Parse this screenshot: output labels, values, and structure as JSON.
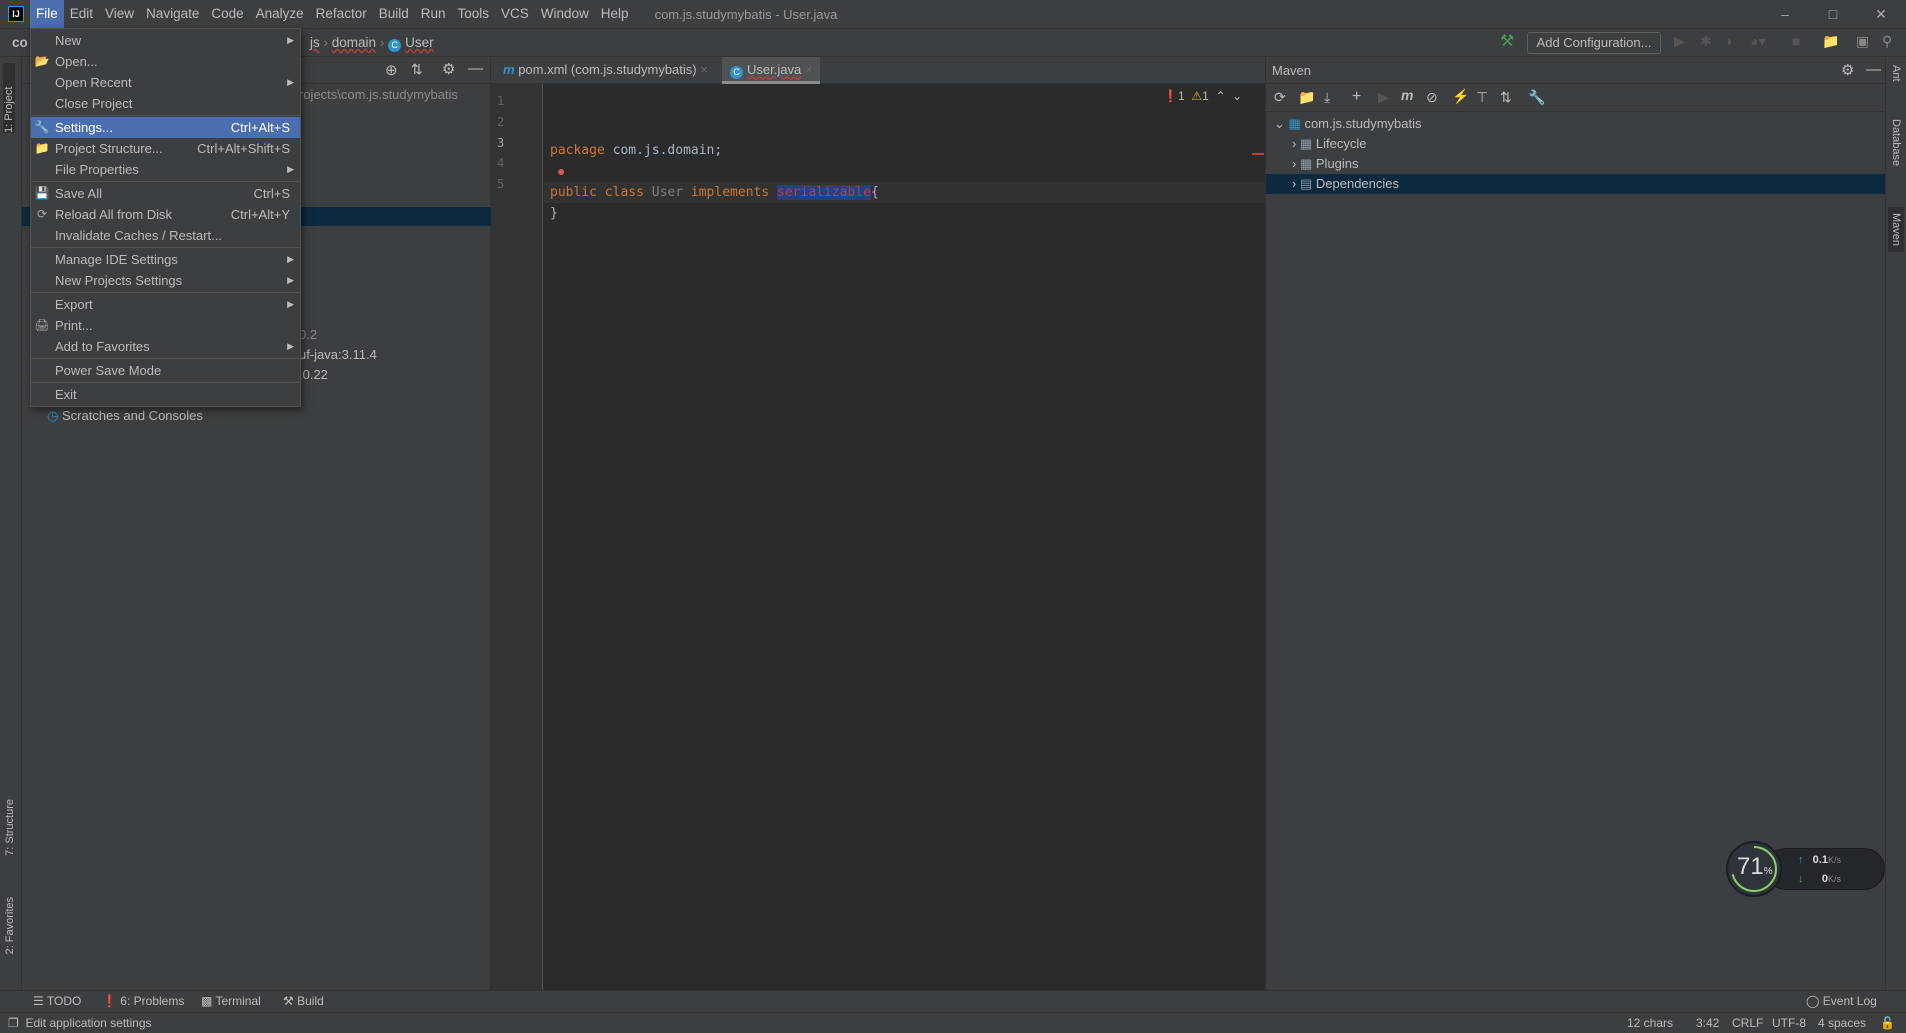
{
  "menubar": {
    "items": [
      "File",
      "Edit",
      "View",
      "Navigate",
      "Code",
      "Analyze",
      "Refactor",
      "Build",
      "Run",
      "Tools",
      "VCS",
      "Window",
      "Help"
    ],
    "active": "File",
    "window_title": "com.js.studymybatis - User.java"
  },
  "navbar": {
    "project_short": "co",
    "crumbs": [
      "js",
      "domain",
      "User"
    ],
    "add_config": "Add Configuration..."
  },
  "file_menu": [
    {
      "label": "New",
      "submenu": true
    },
    {
      "label": "Open...",
      "icon": "folder-open-icon"
    },
    {
      "label": "Open Recent",
      "submenu": true
    },
    {
      "label": "Close Project"
    },
    {
      "sep": true
    },
    {
      "label": "Settings...",
      "shortcut": "Ctrl+Alt+S",
      "icon": "wrench-icon",
      "highlighted": true
    },
    {
      "label": "Project Structure...",
      "shortcut": "Ctrl+Alt+Shift+S",
      "icon": "project-structure-icon"
    },
    {
      "label": "File Properties",
      "submenu": true
    },
    {
      "sep": true
    },
    {
      "label": "Save All",
      "shortcut": "Ctrl+S",
      "icon": "save-icon"
    },
    {
      "label": "Reload All from Disk",
      "shortcut": "Ctrl+Alt+Y",
      "icon": "reload-icon"
    },
    {
      "label": "Invalidate Caches / Restart..."
    },
    {
      "sep": true
    },
    {
      "label": "Manage IDE Settings",
      "submenu": true
    },
    {
      "label": "New Projects Settings",
      "submenu": true
    },
    {
      "sep": true
    },
    {
      "label": "Export",
      "submenu": true
    },
    {
      "label": "Print...",
      "icon": "print-icon"
    },
    {
      "label": "Add to Favorites",
      "submenu": true
    },
    {
      "sep": true
    },
    {
      "label": "Power Save Mode"
    },
    {
      "sep": true
    },
    {
      "label": "Exit"
    }
  ],
  "project": {
    "tool_label": "1: Project",
    "path": "rojects\\com.js.studymybatis",
    "lib1": "0.2",
    "lib2": "uf-java:3.11.4",
    "lib3": ".0.22",
    "scratches": "Scratches and Consoles"
  },
  "editor": {
    "tabs": [
      "pom.xml (com.js.studymybatis)",
      "User.java"
    ],
    "active_tab": "User.java",
    "line_numbers": [
      "1",
      "2",
      "3",
      "4",
      "5"
    ],
    "code": {
      "l1_kw": "package",
      "l1_rest": " com.js.domain;",
      "l3_kw1": "public",
      "l3_kw2": "class",
      "l3_cls": "User",
      "l3_kw3": "implements",
      "l3_err": "serializable",
      "l3_end": "{",
      "l4": "}"
    },
    "errors": "1",
    "warnings": "1"
  },
  "maven": {
    "title": "Maven",
    "tree": [
      {
        "label": "com.js.studymybatis",
        "expanded": true
      },
      {
        "label": "Lifecycle"
      },
      {
        "label": "Plugins"
      },
      {
        "label": "Dependencies",
        "selected": true
      }
    ]
  },
  "right_strip": [
    "Ant",
    "Database",
    "Maven"
  ],
  "left_strip_bottom": [
    "7: Structure",
    "2: Favorites"
  ],
  "bottom_tabs": [
    "TODO",
    "6: Problems",
    "Terminal",
    "Build"
  ],
  "event_log": "Event Log",
  "status": {
    "message": "Edit application settings",
    "chars": "12 chars",
    "position": "3:42",
    "line_sep": "CRLF",
    "encoding": "UTF-8",
    "indent": "4 spaces"
  },
  "monitor": {
    "cpu_percent": "71",
    "percent_sign": "%",
    "up": "0.1",
    "down": "0",
    "unit": "K/s"
  },
  "colors": {
    "accent": "#4b6eaf",
    "selection": "#0d293e",
    "error": "#bc3f3c",
    "keyword": "#cc7832"
  }
}
